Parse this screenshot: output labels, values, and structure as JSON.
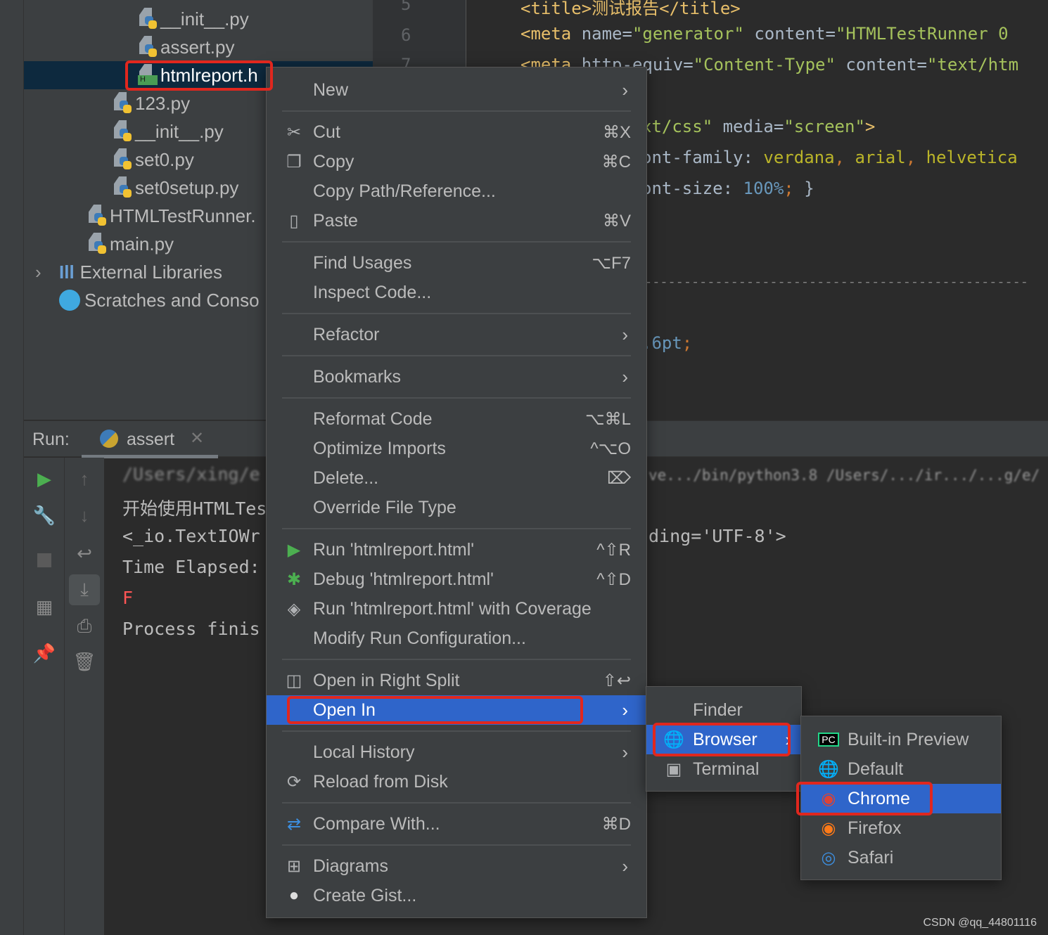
{
  "project_tree": {
    "items": [
      {
        "label": "__init__.py",
        "type": "python"
      },
      {
        "label": "assert.py",
        "type": "python"
      },
      {
        "label": "htmlreport.h",
        "type": "html",
        "selected": true
      },
      {
        "label": "123.py",
        "type": "python"
      },
      {
        "label": "__init__.py",
        "type": "python"
      },
      {
        "label": "set0.py",
        "type": "python"
      },
      {
        "label": "set0setup.py",
        "type": "python"
      },
      {
        "label": "HTMLTestRunner.",
        "type": "python"
      },
      {
        "label": "main.py",
        "type": "python"
      },
      {
        "label": "External Libraries",
        "type": "library"
      },
      {
        "label": "Scratches and Conso",
        "type": "scratches"
      }
    ]
  },
  "editor": {
    "line_numbers": [
      "5",
      "6",
      "7"
    ],
    "lines": {
      "l5_tag": "<title>测试报告</title>",
      "l6_tag": "<meta",
      "l6_attr1": " name=",
      "l6_val1": "\"generator\"",
      "l6_attr2": " content=",
      "l6_val2": "\"HTMLTestRunner 0",
      "l7_tag": "<meta",
      "l7_attr1": " http-equiv=",
      "l7_val1": "\"Content-Type\"",
      "l7_attr2": " content=",
      "l7_val2": "\"text/htm",
      "l9_val": "xt/css\"",
      "l9_attr": " media=",
      "l9_val2": "\"screen\"",
      "l9_end": ">",
      "l10_prop": "ont-family: ",
      "l10_v1": "verdana",
      "l10_c1": ", ",
      "l10_v2": "arial",
      "l10_c2": ", ",
      "l10_v3": "helvetica",
      "l11_prop": "ont-size: ",
      "l11_num": "100%",
      "l11_semi": ";",
      "l11_end": " }",
      "l14_dash": "-------------------------------------------------",
      "l16_num": ".6pt",
      "l16_semi": ";"
    }
  },
  "run_panel": {
    "label": "Run:",
    "tab": "assert",
    "console": [
      "/Users/xing/e",
      "开始使用HTMLTes",
      "<_io.TextIOWr",
      "Time Elapsed:",
      "F",
      "Process finis"
    ],
    "console_right": [
      "ve.../bin/python3.8 /Users/.../ir.../...g/e/",
      "ding='UTF-8'>"
    ]
  },
  "context_menu": {
    "items": [
      {
        "label": "New",
        "submenu": true
      },
      {
        "sep": true
      },
      {
        "label": "Cut",
        "shortcut": "⌘X",
        "icon": "scissors-icon"
      },
      {
        "label": "Copy",
        "shortcut": "⌘C",
        "icon": "copy-icon"
      },
      {
        "label": "Copy Path/Reference..."
      },
      {
        "label": "Paste",
        "shortcut": "⌘V",
        "icon": "paste-icon"
      },
      {
        "sep": true
      },
      {
        "label": "Find Usages",
        "shortcut": "⌥F7"
      },
      {
        "label": "Inspect Code..."
      },
      {
        "sep": true
      },
      {
        "label": "Refactor",
        "submenu": true
      },
      {
        "sep": true
      },
      {
        "label": "Bookmarks",
        "submenu": true
      },
      {
        "sep": true
      },
      {
        "label": "Reformat Code",
        "shortcut": "⌥⌘L"
      },
      {
        "label": "Optimize Imports",
        "shortcut": "^⌥O"
      },
      {
        "label": "Delete...",
        "shortcut": "⌦"
      },
      {
        "label": "Override File Type"
      },
      {
        "sep": true
      },
      {
        "label": "Run 'htmlreport.html'",
        "shortcut": "^⇧R",
        "icon": "run-icon"
      },
      {
        "label": "Debug 'htmlreport.html'",
        "shortcut": "^⇧D",
        "icon": "debug-icon"
      },
      {
        "label": "Run 'htmlreport.html' with Coverage",
        "icon": "coverage-icon"
      },
      {
        "label": "Modify Run Configuration..."
      },
      {
        "sep": true
      },
      {
        "label": "Open in Right Split",
        "shortcut": "⇧↩",
        "icon": "split-icon"
      },
      {
        "label": "Open In",
        "submenu": true,
        "highlighted": true
      },
      {
        "sep": true
      },
      {
        "label": "Local History",
        "submenu": true
      },
      {
        "label": "Reload from Disk",
        "icon": "reload-icon"
      },
      {
        "sep": true
      },
      {
        "label": "Compare With...",
        "shortcut": "⌘D",
        "icon": "compare-icon"
      },
      {
        "sep": true
      },
      {
        "label": "Diagrams",
        "submenu": true,
        "icon": "diagram-icon"
      },
      {
        "label": "Create Gist...",
        "icon": "github-icon"
      }
    ]
  },
  "open_in_menu": {
    "items": [
      {
        "label": "Finder"
      },
      {
        "label": "Browser",
        "submenu": true,
        "highlighted": true,
        "icon": "globe-icon"
      },
      {
        "label": "Terminal",
        "icon": "terminal-icon"
      }
    ]
  },
  "browser_menu": {
    "items": [
      {
        "label": "Built-in Preview",
        "icon": "pycharm-icon"
      },
      {
        "label": "Default",
        "icon": "globe-icon"
      },
      {
        "label": "Chrome",
        "icon": "chrome-icon",
        "highlighted": true
      },
      {
        "label": "Firefox",
        "icon": "firefox-icon"
      },
      {
        "label": "Safari",
        "icon": "safari-icon"
      }
    ]
  },
  "colors": {
    "highlight": "#2f65ca",
    "annotation_red": "#e0271e",
    "selection": "#0d293e"
  },
  "watermark": "CSDN @qq_44801116"
}
